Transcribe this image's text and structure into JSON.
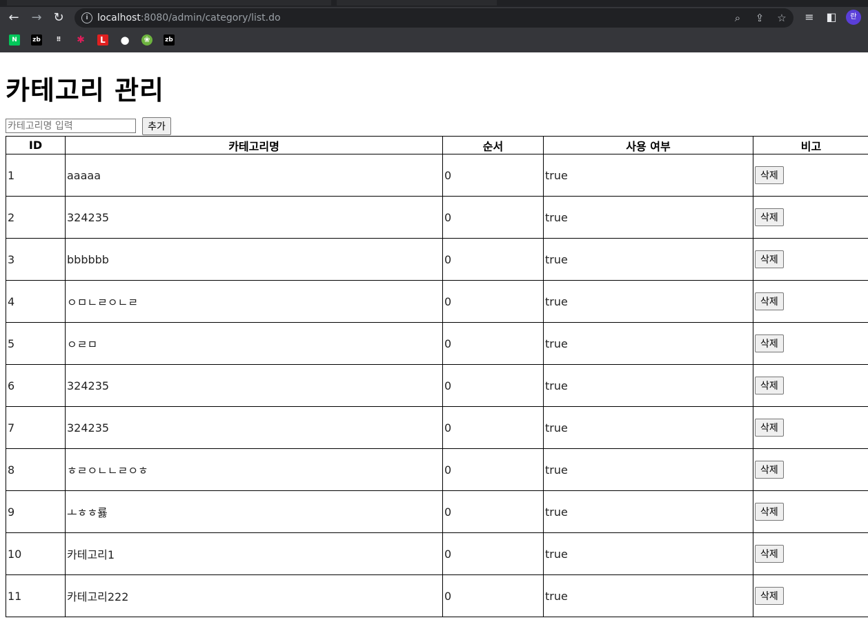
{
  "browser": {
    "url_host": "localhost",
    "url_path": ":8080/admin/category/list.do",
    "profile_initial": "란",
    "bookmarks": [
      {
        "icon": "naver-icon",
        "label": "N",
        "bg": "#03c75a",
        "fg": "#ffffff"
      },
      {
        "icon": "zb-icon",
        "label": "zb",
        "bg": "#000000",
        "fg": "#ffffff"
      },
      {
        "icon": "dots-icon",
        "label": "⠿",
        "bg": "transparent",
        "fg": "#ffffff"
      },
      {
        "icon": "slack-icon",
        "label": "✱",
        "bg": "transparent",
        "fg": "#e01e5a"
      },
      {
        "icon": "l-icon",
        "label": "L",
        "bg": "#e02020",
        "fg": "#ffffff"
      },
      {
        "icon": "github-icon",
        "label": "●",
        "bg": "transparent",
        "fg": "#ffffff"
      },
      {
        "icon": "spring-icon",
        "label": "❀",
        "bg": "#6db33f",
        "fg": "#ffffff"
      },
      {
        "icon": "zb-icon",
        "label": "zb",
        "bg": "#000000",
        "fg": "#ffffff"
      }
    ]
  },
  "page": {
    "title": "카테고리 관리",
    "input_placeholder": "카테고리명 입력",
    "add_label": "추가"
  },
  "table": {
    "headers": [
      "ID",
      "카테고리명",
      "순서",
      "사용 여부",
      "비고"
    ],
    "delete_label": "삭제",
    "rows": [
      {
        "id": "1",
        "name": "aaaaa",
        "order": "0",
        "used": "true"
      },
      {
        "id": "2",
        "name": "324235",
        "order": "0",
        "used": "true"
      },
      {
        "id": "3",
        "name": "bbbbbb",
        "order": "0",
        "used": "true"
      },
      {
        "id": "4",
        "name": "ㅇㅁㄴㄹㅇㄴㄹ",
        "order": "0",
        "used": "true"
      },
      {
        "id": "5",
        "name": "ㅇㄹㅁ",
        "order": "0",
        "used": "true"
      },
      {
        "id": "6",
        "name": "324235",
        "order": "0",
        "used": "true"
      },
      {
        "id": "7",
        "name": "324235",
        "order": "0",
        "used": "true"
      },
      {
        "id": "8",
        "name": "ㅎㄹㅇㄴㄴㄹㅇㅎ",
        "order": "0",
        "used": "true"
      },
      {
        "id": "9",
        "name": "ㅗㅎㅎ룛",
        "order": "0",
        "used": "true"
      },
      {
        "id": "10",
        "name": "카테고리1",
        "order": "0",
        "used": "true"
      },
      {
        "id": "11",
        "name": "카테고리222",
        "order": "0",
        "used": "true"
      }
    ]
  }
}
